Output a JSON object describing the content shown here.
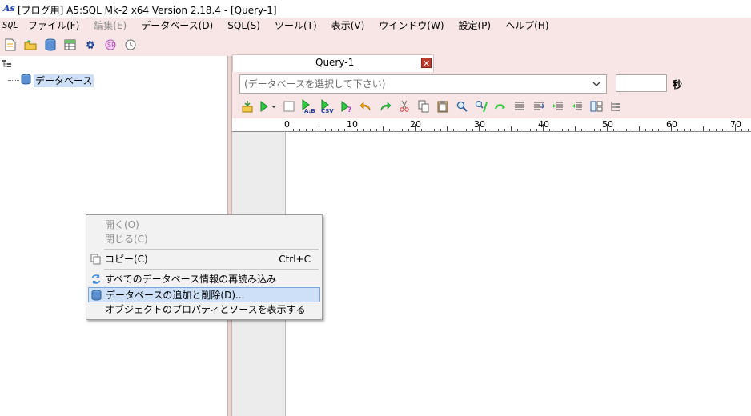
{
  "window": {
    "title": "[ブログ用] A5:SQL Mk-2 x64 Version 2.18.4 - [Query-1]",
    "logo_text": "As"
  },
  "menubar": {
    "sql_logo": "SQL",
    "items": [
      {
        "label": "ファイル(F)",
        "disabled": false
      },
      {
        "label": "編集(E)",
        "disabled": true
      },
      {
        "label": "データベース(D)",
        "disabled": false
      },
      {
        "label": "SQL(S)",
        "disabled": false
      },
      {
        "label": "ツール(T)",
        "disabled": false
      },
      {
        "label": "表示(V)",
        "disabled": false
      },
      {
        "label": "ウインドウ(W)",
        "disabled": false
      },
      {
        "label": "設定(P)",
        "disabled": false
      },
      {
        "label": "ヘルプ(H)",
        "disabled": false
      }
    ]
  },
  "toolbar": {
    "icons": [
      "new-query-icon",
      "open-folder-icon",
      "database-icon",
      "table-icon",
      "settings-gear-icon",
      "plugin-icon",
      "clock-icon"
    ]
  },
  "tree": {
    "root_label": "データベース"
  },
  "query_tab": {
    "label": "Query-1",
    "close_glyph": "✕"
  },
  "query_panel": {
    "db_select_placeholder": "(データベースを選択して下さい)",
    "timeout_value": "",
    "seconds_label": "秒",
    "toolbar_icons": [
      "explain-icon",
      "run-icon",
      "stop-icon",
      "run-ab-icon",
      "run-csv-icon",
      "run-help-icon",
      "undo-icon",
      "redo-icon",
      "cut-icon",
      "copy-icon",
      "paste-icon",
      "find-icon",
      "replace-icon",
      "wrap-icon",
      "align-icon",
      "format-icon",
      "indent-icon",
      "outdent-icon",
      "layout-icon",
      "tree-icon"
    ]
  },
  "ruler": {
    "labels": [
      "0",
      "10",
      "20",
      "30",
      "40",
      "50",
      "60",
      "70"
    ]
  },
  "context_menu": {
    "items": [
      {
        "label": "開く(O)",
        "shortcut": "",
        "disabled": true,
        "icon": ""
      },
      {
        "label": "閉じる(C)",
        "shortcut": "",
        "disabled": true,
        "icon": ""
      },
      {
        "label": "コピー(C)",
        "shortcut": "Ctrl+C",
        "disabled": false,
        "icon": "copy-icon"
      },
      {
        "label": "すべてのデータベース情報の再読み込み",
        "shortcut": "",
        "disabled": false,
        "icon": "refresh-icon"
      },
      {
        "label": "データベースの追加と削除(D)...",
        "shortcut": "",
        "disabled": false,
        "icon": "database-icon",
        "highlighted": true
      },
      {
        "label": "オブジェクトのプロパティとソースを表示する",
        "shortcut": "",
        "disabled": false,
        "icon": ""
      }
    ]
  },
  "colors": {
    "chrome_pink": "#f8e6e6",
    "highlight": "#cde0f7",
    "disabled_text": "#8d8d8d"
  }
}
